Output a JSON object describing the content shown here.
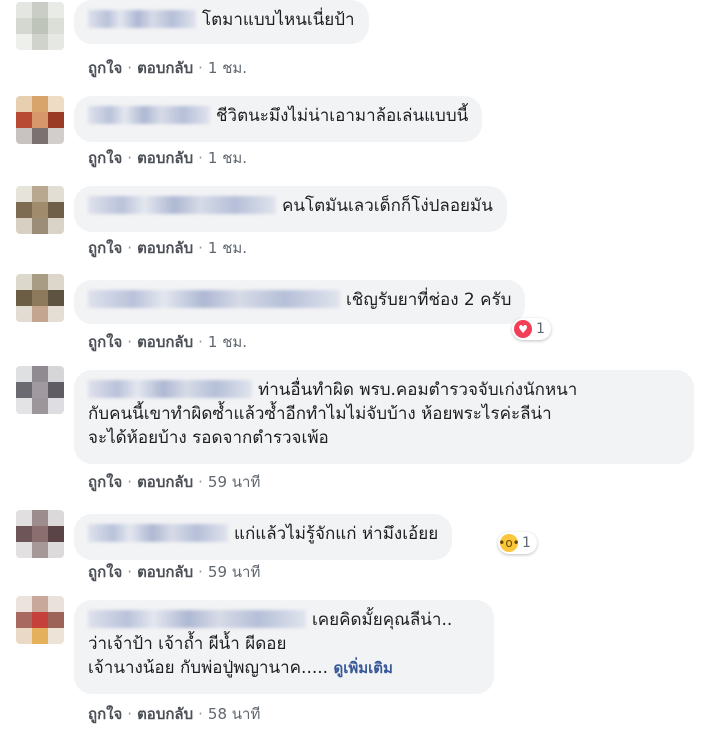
{
  "actions": {
    "like": "ถูกใจ",
    "reply": "ตอบกลับ",
    "separator": "·"
  },
  "comments": [
    {
      "text": "โตมาแบบไหนเนี่ยป้า",
      "time": "1 ชม."
    },
    {
      "text": "ชีวิตนะมึงไม่น่าเอามาล้อเล่นแบบนี้",
      "time": "1 ชม."
    },
    {
      "text": "คนโตมันเลวเด็กก็โง่ปลอยมัน",
      "time": "1 ชม."
    },
    {
      "text": "เชิญรับยาที่ช่อง 2 ครับ",
      "time": "1 ชม.",
      "reaction": {
        "icon": "love-reaction-icon",
        "count": "1"
      }
    },
    {
      "lines": [
        "ท่านอื่นทำผิด พรบ.คอมตำรวจจับเก่งนักหนา",
        "กับคนนี้เขาทำผิดซ้ำแล้วซ้ำอีกทำไมไม่จับบ้าง ห้อยพระไรค่ะลีน่า",
        "จะได้ห้อยบ้าง รอดจากตำรวจเพ้อ"
      ],
      "time": "59 นาที"
    },
    {
      "text": "แก่แล้วไม่รู้จักแก่ ห่ามึงเอ้ยย",
      "time": "59 นาที",
      "reaction": {
        "icon": "wow-reaction-icon",
        "count": "1"
      }
    },
    {
      "lines": [
        "เคยคิดมั้ยคุณลีน่า..",
        "ว่าเจ้าป้า เจ้าถ้ำ ผีน้ำ ผีดอย",
        "เจ้านางน้อย กับพ่อปู่พญานาค....."
      ],
      "see_more": "ดูเพิ่มเติม",
      "time": "58 นาที"
    }
  ],
  "colors": {
    "bubble": "#f2f3f5",
    "link": "#385898",
    "love": "#f33e58",
    "wow": "#fcc63c"
  }
}
